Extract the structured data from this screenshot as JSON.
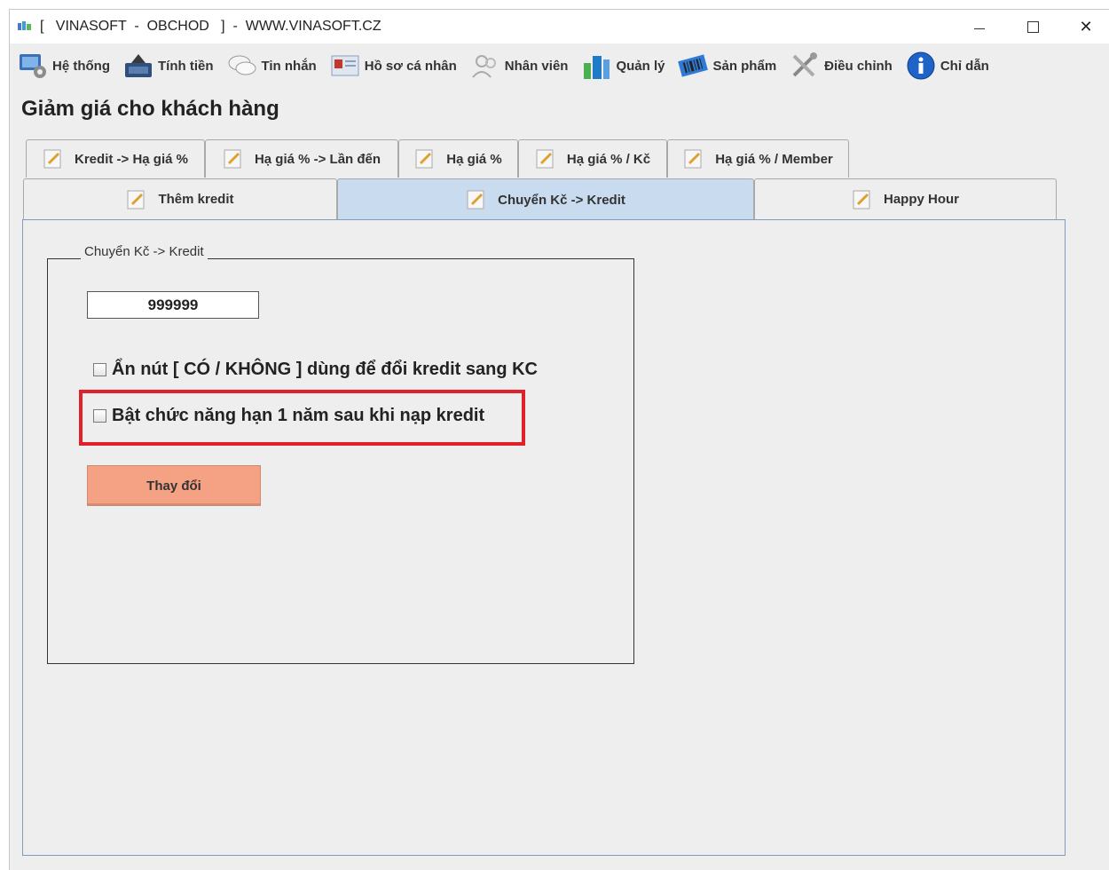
{
  "window": {
    "title": "[   VINASOFT  -  OBCHOD   ]  -  WWW.VINASOFT.CZ",
    "minimize_symbol": "—",
    "close_symbol": "✕"
  },
  "menu": {
    "items": [
      {
        "label": "Hệ thống",
        "icon": "system-icon"
      },
      {
        "label": "Tính tiền",
        "icon": "cash-register-icon"
      },
      {
        "label": "Tin nhắn",
        "icon": "messages-icon"
      },
      {
        "label": "Hồ sơ cá nhân",
        "icon": "profile-card-icon"
      },
      {
        "label": "Nhân viên",
        "icon": "employees-icon"
      },
      {
        "label": "Quản lý",
        "icon": "management-icon"
      },
      {
        "label": "Sản phẩm",
        "icon": "barcode-icon"
      },
      {
        "label": "Điều chỉnh",
        "icon": "tools-icon"
      },
      {
        "label": "Chỉ dẫn",
        "icon": "info-icon"
      }
    ]
  },
  "page": {
    "title": "Giảm giá cho khách hàng"
  },
  "tabs": {
    "row1": [
      {
        "label": "Kredit -> Hạ giá %"
      },
      {
        "label": "Hạ giá % -> Lần đến"
      },
      {
        "label": "Hạ giá %"
      },
      {
        "label": "Hạ giá % / Kč"
      },
      {
        "label": "Hạ giá % / Member"
      }
    ],
    "row2": [
      {
        "label": "Thêm kredit",
        "active": false
      },
      {
        "label": "Chuyển Kč -> Kredit",
        "active": true
      },
      {
        "label": "Happy Hour",
        "active": false
      }
    ]
  },
  "group": {
    "title": "Chuyển Kč -> Kredit",
    "amount_value": "999999",
    "checkbox_hide_buttons": {
      "label": "Ẩn nút [ CÓ / KHÔNG ] dùng để đổi kredit sang KC",
      "checked": false
    },
    "checkbox_expiry": {
      "label": "Bật chức năng hạn 1 năm sau khi nạp kredit",
      "checked": false
    },
    "change_button": "Thay đổi"
  },
  "colors": {
    "active_tab": "#c9dcef",
    "button": "#f5a183",
    "highlight": "#e0202a",
    "pane_border": "#7d9cbf"
  }
}
